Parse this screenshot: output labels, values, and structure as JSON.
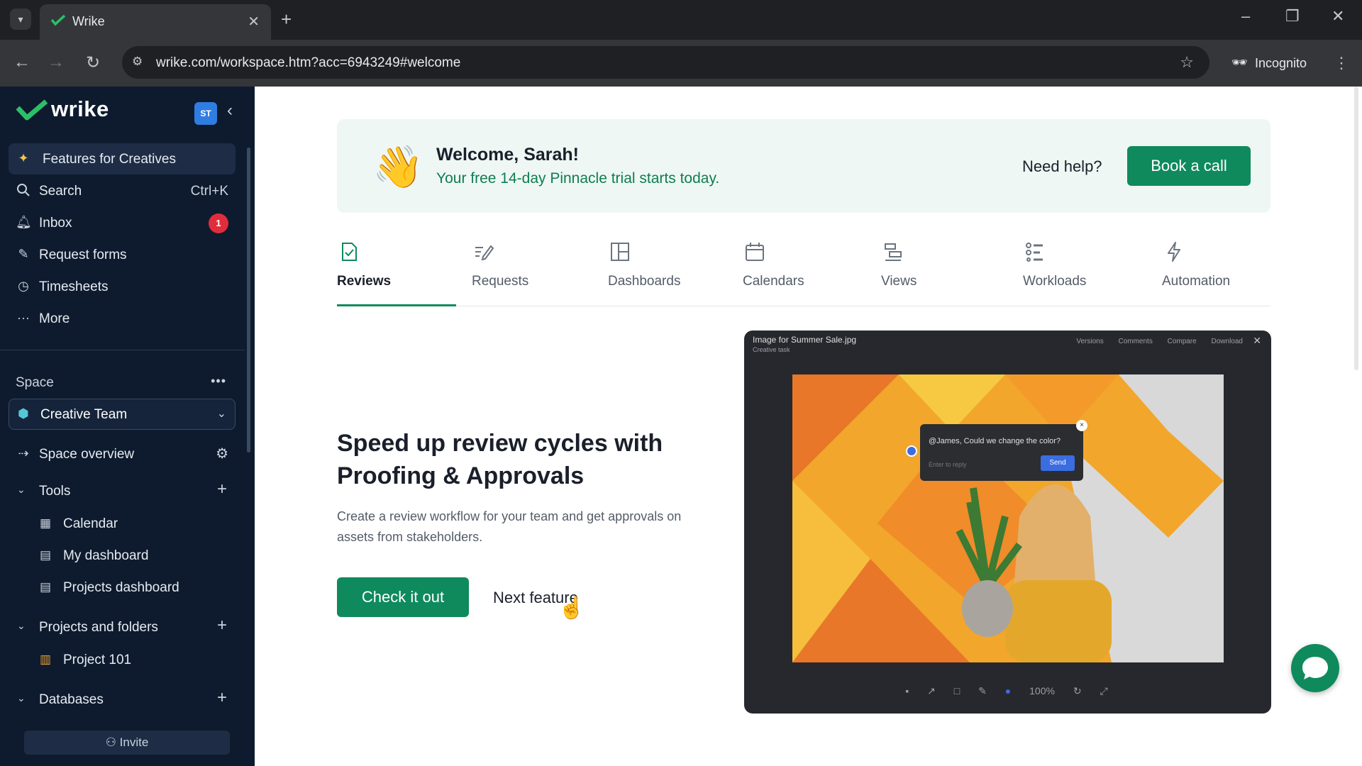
{
  "browser": {
    "tab_title": "Wrike",
    "url": "wrike.com/workspace.htm?acc=6943249#welcome",
    "incognito_label": "Incognito"
  },
  "sidebar": {
    "brand": "wrike",
    "user_initials": "ST",
    "nav": [
      {
        "label": "Features for Creatives",
        "icon": "sparkle-icon"
      },
      {
        "label": "Search",
        "shortcut": "Ctrl+K",
        "icon": "search-icon"
      },
      {
        "label": "Inbox",
        "badge": "1",
        "icon": "bell-icon"
      },
      {
        "label": "Request forms",
        "icon": "form-icon"
      },
      {
        "label": "Timesheets",
        "icon": "clock-icon"
      },
      {
        "label": "More",
        "icon": "dots-icon"
      }
    ],
    "space_heading": "Space",
    "space_selected": "Creative Team",
    "space_overview": "Space overview",
    "tools": {
      "heading": "Tools",
      "items": [
        "Calendar",
        "My dashboard",
        "Projects dashboard"
      ]
    },
    "projects": {
      "heading": "Projects and folders",
      "items": [
        "Project 101"
      ]
    },
    "databases_heading": "Databases",
    "invite_label": "Invite"
  },
  "welcome": {
    "title": "Welcome, Sarah!",
    "subtitle": "Your free 14-day Pinnacle trial starts today.",
    "need_help": "Need help?",
    "book_call": "Book a call"
  },
  "feature_tabs": [
    {
      "label": "Reviews",
      "icon": "review-check-icon",
      "active": true
    },
    {
      "label": "Requests",
      "icon": "edit-list-icon"
    },
    {
      "label": "Dashboards",
      "icon": "dashboard-icon"
    },
    {
      "label": "Calendars",
      "icon": "calendar-icon"
    },
    {
      "label": "Views",
      "icon": "views-icon"
    },
    {
      "label": "Workloads",
      "icon": "workload-icon"
    },
    {
      "label": "Automation",
      "icon": "lightning-icon"
    }
  ],
  "feature": {
    "title": "Speed up review cycles with Proofing & Approvals",
    "description": "Create a review workflow for your team and get approvals on assets from stakeholders.",
    "primary_button": "Check it out",
    "secondary_button": "Next feature"
  },
  "preview": {
    "file_title": "Image for Summer Sale.jpg",
    "file_subtitle": "Creative task",
    "toolbar": "Versions Comments Compare Download",
    "comment_text": "@James, Could we change the color?",
    "comment_placeholder": "Enter to reply",
    "send_label": "Send",
    "zoom": "100%"
  },
  "colors": {
    "brand_green": "#0f8a5c",
    "sidebar_bg": "#0e1b2e",
    "badge_red": "#e02d3c"
  }
}
